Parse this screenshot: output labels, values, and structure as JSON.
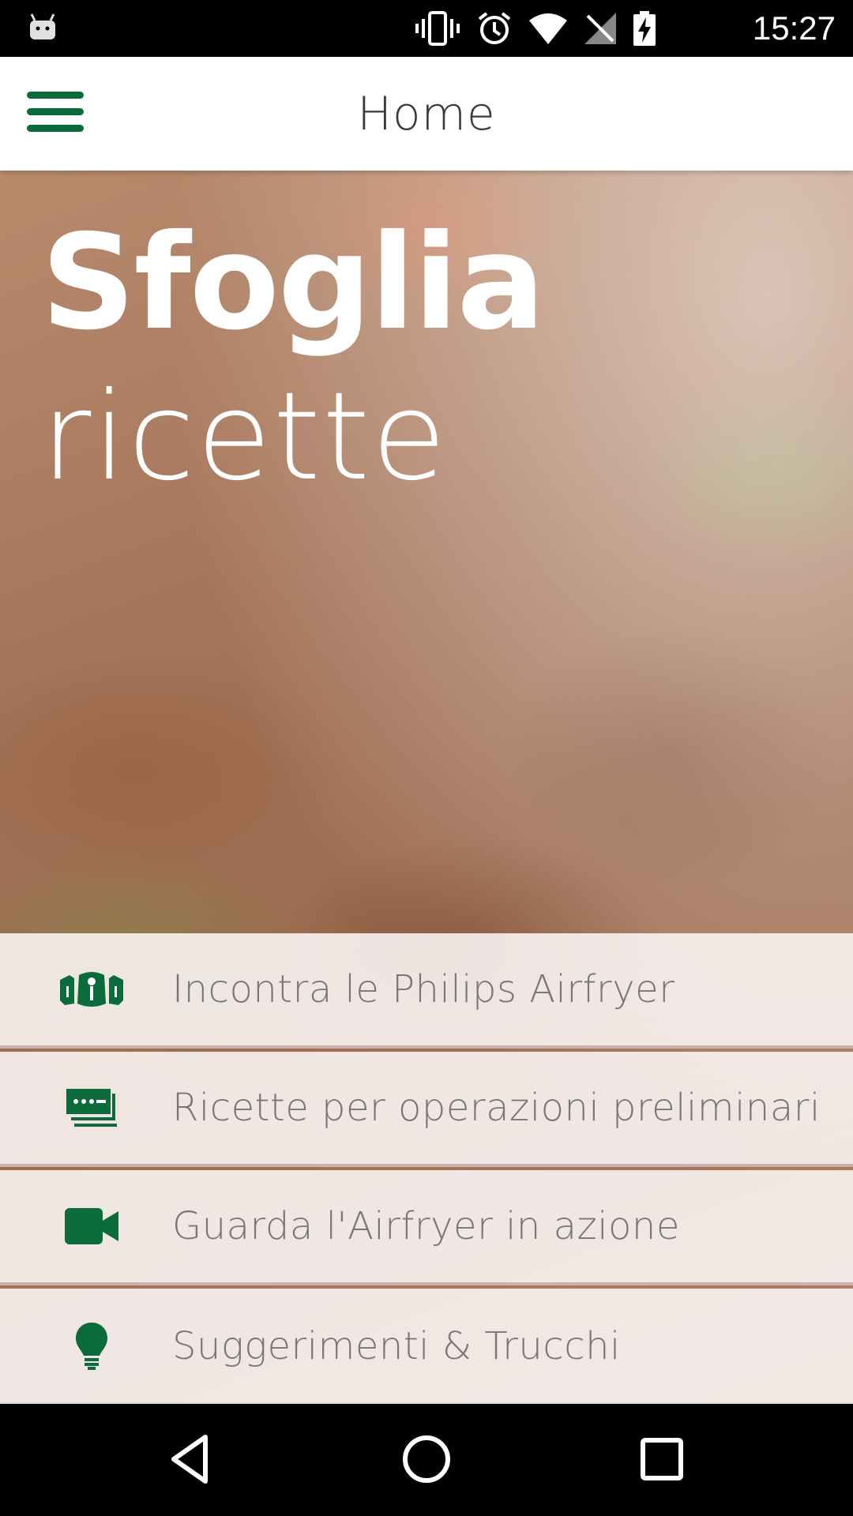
{
  "status_bar": {
    "time": "15:27",
    "icons": [
      "android-icon",
      "vibrate-icon",
      "alarm-icon",
      "wifi-icon",
      "signal-icon",
      "battery-charging-icon"
    ]
  },
  "app_bar": {
    "title": "Home",
    "menu_icon": "hamburger-menu-icon"
  },
  "hero": {
    "title_bold": "Sfoglia",
    "title_light": "ricette"
  },
  "menu": {
    "items": [
      {
        "label": "Incontra le Philips Airfryer",
        "icon": "airfryer-models-icon"
      },
      {
        "label": "Ricette per operazioni preliminari",
        "icon": "recipe-cards-icon"
      },
      {
        "label": "Guarda l'Airfryer in azione",
        "icon": "video-camera-icon"
      },
      {
        "label": "Suggerimenti & Trucchi",
        "icon": "lightbulb-icon"
      }
    ]
  },
  "colors": {
    "accent": "#0b6b3a",
    "appbar_bg": "#ffffff",
    "label_text": "#777777"
  },
  "nav_bar": {
    "buttons": [
      "back-icon",
      "home-icon",
      "recent-apps-icon"
    ]
  }
}
